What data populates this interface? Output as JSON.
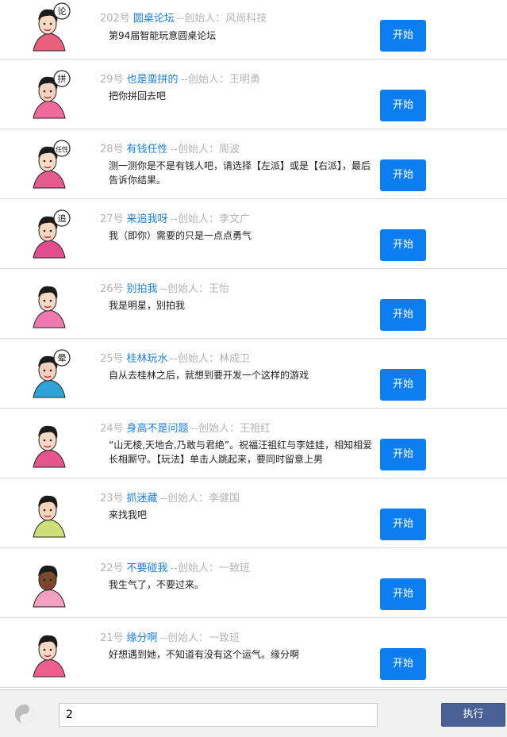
{
  "games": [
    {
      "num": "202号",
      "title": "圆桌论坛",
      "creator": "--创始人：风尚科技",
      "desc": "第94届智能玩意圆桌论坛",
      "start": "开始",
      "icon": "round-table-cartoon-icon",
      "tag": "论"
    },
    {
      "num": "29号",
      "title": "也是蛮拼的",
      "creator": "--创始人：王明勇",
      "desc": "把你拼回去吧",
      "start": "开始",
      "icon": "puzzle-cartoon-icon",
      "tag": "拼"
    },
    {
      "num": "28号",
      "title": "有钱任性",
      "creator": "--创始人：周波",
      "desc": "测一测你是不是有钱人吧，请选择【左派】或是【右派】，最后告诉你结果。",
      "start": "开始",
      "icon": "rich-shopping-cartoon-icon",
      "tag": "任性"
    },
    {
      "num": "27号",
      "title": "来追我呀",
      "creator": "--创始人：李文广",
      "desc": "我（即你）需要的只是一点点勇气",
      "start": "开始",
      "icon": "running-cartoon-icon",
      "tag": "追"
    },
    {
      "num": "26号",
      "title": "别拍我",
      "creator": "--创始人：王怡",
      "desc": "我是明星，别拍我",
      "start": "开始",
      "icon": "star-cartoon-icon",
      "tag": ""
    },
    {
      "num": "25号",
      "title": "桂林玩水",
      "creator": "--创始人：林成卫",
      "desc": "自从去桂林之后，就想到要开发一个这样的游戏",
      "start": "开始",
      "icon": "water-play-cartoon-icon",
      "tag": "晕"
    },
    {
      "num": "24号",
      "title": "身高不是问题",
      "creator": "--创始人：王祖红",
      "desc": "“山无棱,天地合,乃敢与君绝”。祝福汪祖红与李娃娃，相知相爱长相厮守。【玩法】单击人跳起来，要同时留意上男",
      "start": "开始",
      "icon": "mustache-man-cartoon-icon",
      "tag": ""
    },
    {
      "num": "23号",
      "title": "抓迷藏",
      "creator": "--创始人：李健国",
      "desc": "来找我吧",
      "start": "开始",
      "icon": "hide-seek-cartoon-icon",
      "tag": ""
    },
    {
      "num": "22号",
      "title": "不要碰我",
      "creator": "--创始人：一致班",
      "desc": "我生气了，不要过来。",
      "start": "开始",
      "icon": "angry-couple-cartoon-icon",
      "tag": ""
    },
    {
      "num": "21号",
      "title": "缘分啊",
      "creator": "--创始人：一致班",
      "desc": "好想遇到她，不知道有没有这个运气。缘分啊",
      "start": "开始",
      "icon": "love-cartoon-icon",
      "tag": ""
    }
  ],
  "bottom": {
    "input_value": "2",
    "exec_label": "执行",
    "yin_yang_icon": "yin-yang-icon"
  },
  "colors": {
    "start_button": "#0d7ef2",
    "exec_button": "#4a6195",
    "title_link": "#1e7fdc"
  }
}
